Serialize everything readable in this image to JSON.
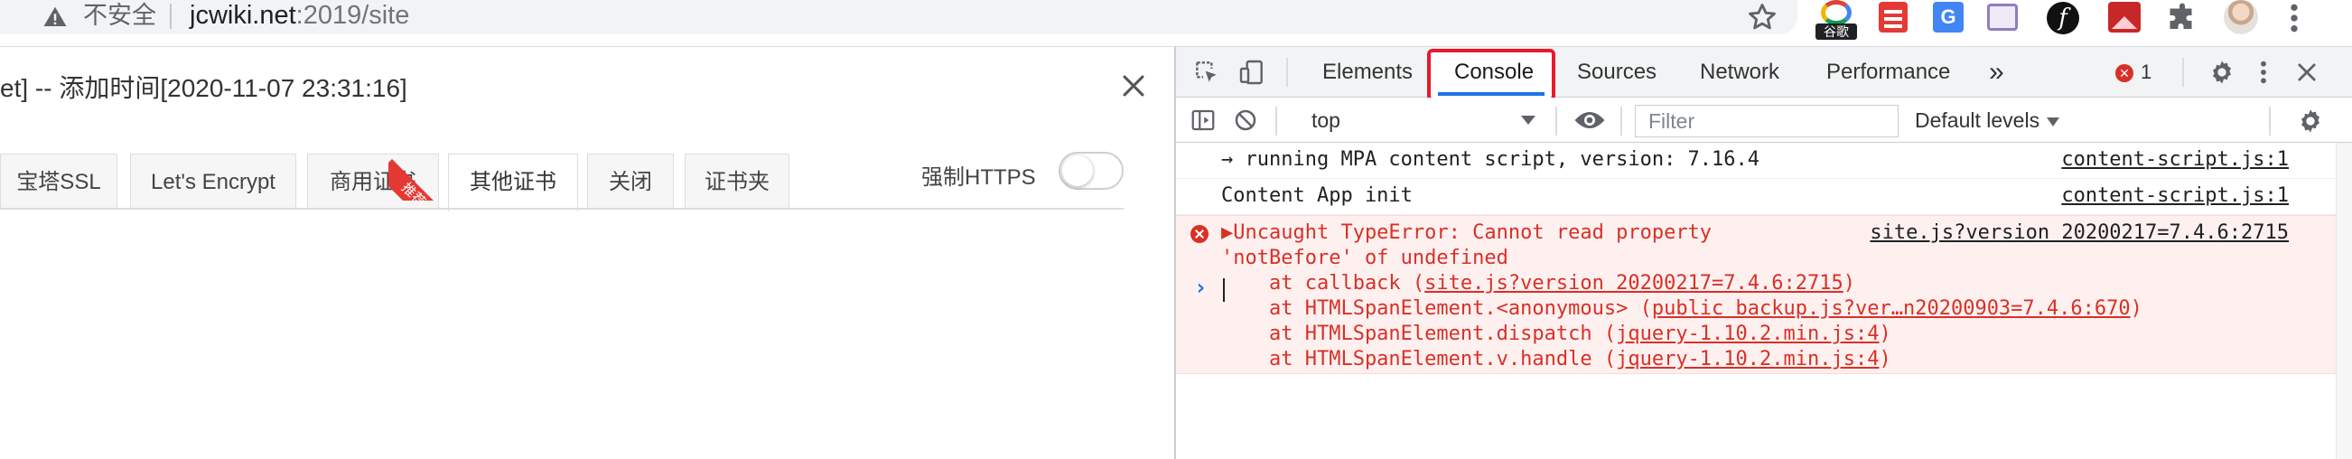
{
  "chrome": {
    "insecure_label": "不安全",
    "url_host": "jcwiki.net",
    "url_path": ":2019/site",
    "google_ext_label": "谷歌",
    "translate_ext_label": "G"
  },
  "modal": {
    "title": "et] -- 添加时间[2020-11-07 23:31:16]",
    "tabs": [
      {
        "label": "宝塔SSL"
      },
      {
        "label": "Let's Encrypt"
      },
      {
        "label": "商用证书"
      },
      {
        "label": "其他证书"
      },
      {
        "label": "关闭"
      },
      {
        "label": "证书夹"
      }
    ],
    "ribbon_label": "推荐",
    "https_label": "强制HTTPS"
  },
  "devtools": {
    "tabs": [
      "Elements",
      "Console",
      "Sources",
      "Network",
      "Performance"
    ],
    "more": "»",
    "error_count": "1",
    "context": "top",
    "filter_placeholder": "Filter",
    "levels": "Default levels",
    "messages": [
      {
        "text": "→ running MPA content script, version: 7.16.4",
        "source": "content-script.js:1"
      },
      {
        "text": "Content App init",
        "source": "content-script.js:1"
      }
    ],
    "error": {
      "line1": "▶Uncaught TypeError: Cannot read property",
      "line2": "'notBefore' of undefined",
      "source": "site.js?version 20200217=7.4.6:2715",
      "stack": [
        {
          "prefix": "    at callback (",
          "link": "site.js?version 20200217=7.4.6:2715",
          "suffix": ")"
        },
        {
          "prefix": "    at HTMLSpanElement.<anonymous> (",
          "link": "public backup.js?ver…n20200903=7.4.6:670",
          "suffix": ")"
        },
        {
          "prefix": "    at HTMLSpanElement.dispatch (",
          "link": "jquery-1.10.2.min.js:4",
          "suffix": ")"
        },
        {
          "prefix": "    at HTMLSpanElement.v.handle (",
          "link": "jquery-1.10.2.min.js:4",
          "suffix": ")"
        }
      ]
    },
    "prompt": "›"
  }
}
